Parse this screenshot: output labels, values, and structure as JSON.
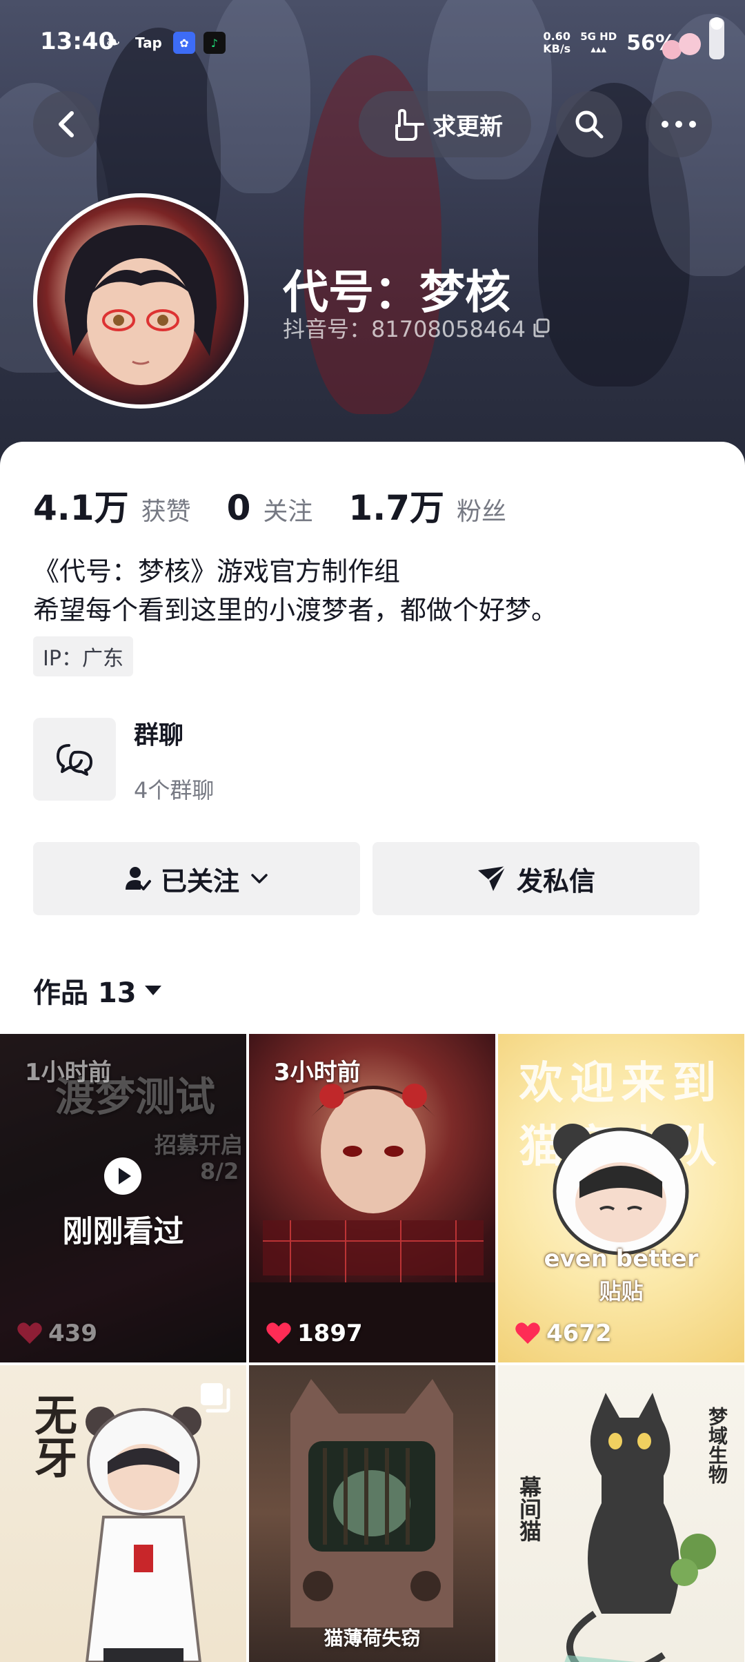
{
  "status_bar": {
    "time": "13:40",
    "net_speed_value": "0.60",
    "net_speed_unit": "KB/s",
    "network": "5G HD",
    "battery": "56%",
    "tap_label": "Tap"
  },
  "header": {
    "request_update_label": "求更新"
  },
  "profile": {
    "nickname": "代号：梦核",
    "douyin_id": "抖音号：81708058464",
    "stats": [
      {
        "value": "4.1万",
        "label": "获赞"
      },
      {
        "value": "0",
        "label": "关注"
      },
      {
        "value": "1.7万",
        "label": "粉丝"
      }
    ],
    "bio_line1": "《代号：梦核》游戏官方制作组",
    "bio_line2": "希望每个看到这里的小渡梦者，都做个好梦。",
    "ip": "IP：广东",
    "group_title": "群聊",
    "group_count": "4个群聊"
  },
  "actions": {
    "following_label": "已关注",
    "message_label": "发私信"
  },
  "works": {
    "tab_label": "作品 13",
    "items": [
      {
        "time": "1小时前",
        "likes": "439",
        "title_line1": "渡梦测试",
        "title_line2": "招募开启",
        "date": "8/2",
        "watched": "刚刚看过"
      },
      {
        "time": "3小时前",
        "likes": "1897"
      },
      {
        "likes": "4672",
        "title": "欢迎来到猫窝小队",
        "caption_line1": "even better",
        "caption_line2": "贴贴"
      },
      {
        "likes": "",
        "title": "无牙"
      },
      {
        "likes": "",
        "title": "猫薄荷失窃"
      },
      {
        "likes": "",
        "title": "梦域生物",
        "subtitle": "幕间猫"
      }
    ]
  },
  "colors": {
    "accent_red": "#fe2c55",
    "text_primary": "#161823",
    "text_secondary": "#767983",
    "button_bg": "#f1f1f2"
  }
}
